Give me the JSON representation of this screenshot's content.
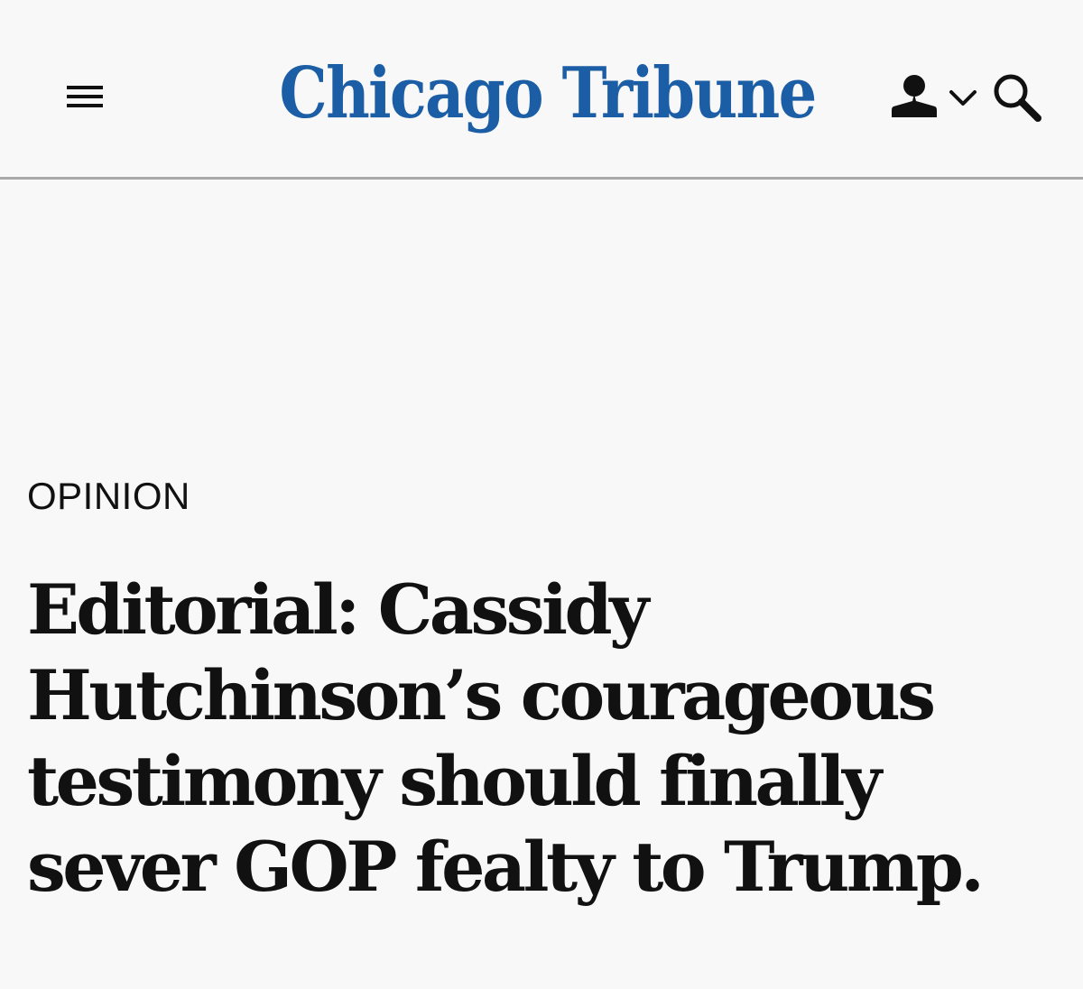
{
  "header": {
    "logo_text": "Chicago Tribune",
    "brand_color": "#1c5ea5",
    "menu_icon": "hamburger-icon",
    "account_icon": "user-icon",
    "account_dropdown_icon": "chevron-down-icon",
    "search_icon": "search-icon"
  },
  "article": {
    "section": "OPINION",
    "headline": "Editorial: Cassidy Hutchinson’s courageous testimony should finally sever GOP fealty to Trump."
  }
}
